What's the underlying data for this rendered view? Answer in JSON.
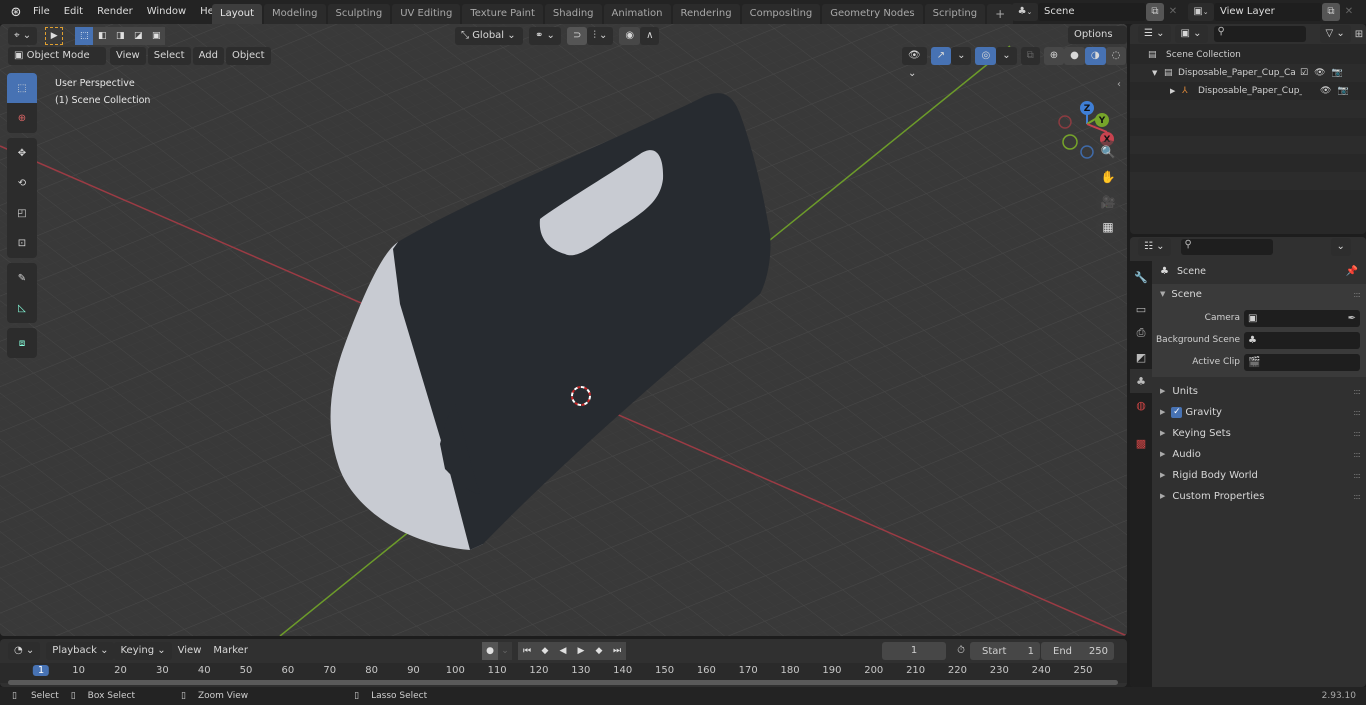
{
  "topbar": {
    "menus": [
      "File",
      "Edit",
      "Render",
      "Window",
      "Help"
    ],
    "workspace_tabs": [
      "Layout",
      "Modeling",
      "Sculpting",
      "UV Editing",
      "Texture Paint",
      "Shading",
      "Animation",
      "Rendering",
      "Compositing",
      "Geometry Nodes",
      "Scripting"
    ],
    "active_tab": "Layout",
    "add_tab": "+",
    "scene_name": "Scene",
    "view_layer": "View Layer"
  },
  "viewport": {
    "mode": "Object Mode",
    "menus": [
      "View",
      "Select",
      "Add",
      "Object"
    ],
    "transform_orientation": "Global",
    "options_label": "Options",
    "overlay_line1": "User Perspective",
    "overlay_line2": "(1) Scene Collection",
    "gizmo": {
      "x": "X",
      "y": "Y",
      "z": "Z"
    },
    "colors": {
      "x_axis": "#c8434f",
      "y_axis": "#76a52a",
      "z_axis": "#3f7fd6",
      "object_dark": "#272b30",
      "object_light": "#c8cbd2",
      "grid_bg": "#393939",
      "active_tool": "#4772b3"
    }
  },
  "outliner": {
    "root": "Scene Collection",
    "items": [
      {
        "label": "Disposable_Paper_Cup_Carrie",
        "type": "collection"
      },
      {
        "label": "Disposable_Paper_Cup_C",
        "type": "object"
      }
    ]
  },
  "properties": {
    "context_title": "Scene",
    "section_title": "Scene",
    "fields": [
      {
        "label": "Camera",
        "value": ""
      },
      {
        "label": "Background Scene",
        "value": ""
      },
      {
        "label": "Active Clip",
        "value": ""
      }
    ],
    "subpanels": [
      {
        "label": "Units",
        "checkbox": false
      },
      {
        "label": "Gravity",
        "checkbox": true
      },
      {
        "label": "Keying Sets",
        "checkbox": false
      },
      {
        "label": "Audio",
        "checkbox": false
      },
      {
        "label": "Rigid Body World",
        "checkbox": false
      },
      {
        "label": "Custom Properties",
        "checkbox": false
      }
    ]
  },
  "timeline": {
    "menus": [
      "Playback",
      "Keying",
      "View",
      "Marker"
    ],
    "current_frame": "1",
    "start_label": "Start",
    "start": "1",
    "end_label": "End",
    "end": "250",
    "ticks": [
      "1",
      "10",
      "20",
      "30",
      "40",
      "50",
      "60",
      "70",
      "80",
      "90",
      "100",
      "110",
      "120",
      "130",
      "140",
      "150",
      "160",
      "170",
      "180",
      "190",
      "200",
      "210",
      "220",
      "230",
      "240",
      "250"
    ]
  },
  "statusbar": {
    "hints": [
      "Select",
      "Box Select",
      "Zoom View",
      "Lasso Select"
    ],
    "version": "2.93.10"
  }
}
